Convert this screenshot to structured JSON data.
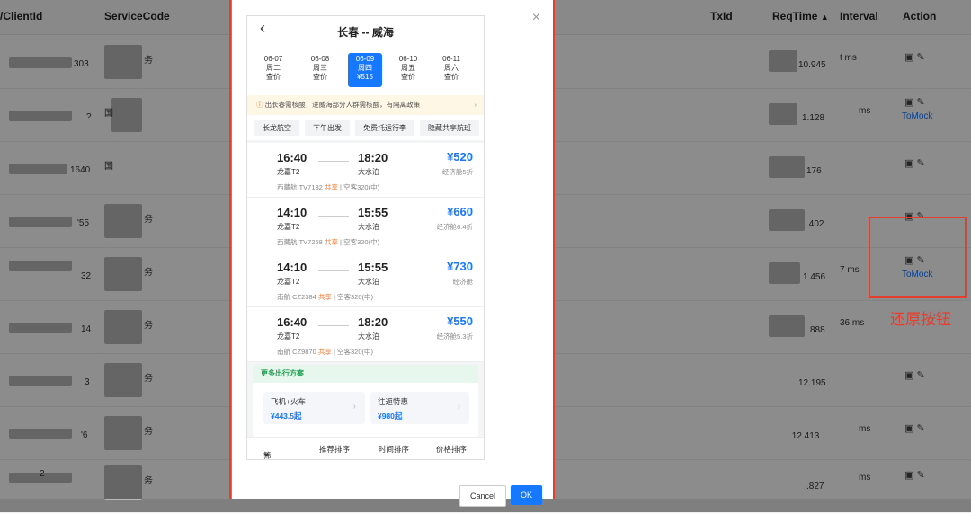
{
  "table": {
    "columns": [
      "/ClientId",
      "ServiceCode",
      "TxId",
      "ReqTime",
      "Interval",
      "Action"
    ],
    "sort_indicator": "▲"
  },
  "rows_visible": [
    {
      "client_frag": "303",
      "svc": "务",
      "req": "10.945",
      "interval": "t ms"
    },
    {
      "client_frag": "?",
      "svc": "国",
      "req": "1.128",
      "interval": "ms",
      "tomock": "ToMock"
    },
    {
      "client_frag": "1640",
      "svc": "国",
      "req": "176",
      "interval": ""
    },
    {
      "client_frag": "'55",
      "svc": "务",
      "req": ".402",
      "interval": ""
    },
    {
      "client_frag": "32",
      "svc": "务",
      "req": "1.456",
      "interval": "7 ms",
      "tomock": "ToMock"
    },
    {
      "client_frag": "14",
      "svc": "务",
      "req": "888",
      "interval": "36 ms"
    },
    {
      "client_frag": "3",
      "svc": "务",
      "req": "12.195",
      "interval": ""
    },
    {
      "client_frag": "'6",
      "svc": "务",
      "req": ".12.413",
      "interval": "ms"
    },
    {
      "client_frag": "2",
      "svc": "务",
      "req": ".827",
      "interval": "ms"
    }
  ],
  "annotation": {
    "label": "还原按钮",
    "color": "#e53e2e"
  },
  "modal": {
    "close": "×",
    "route_title": "长春 -- 威海",
    "dates": [
      {
        "date": "06-07",
        "weekday": "周二",
        "price": "查价"
      },
      {
        "date": "06-08",
        "weekday": "周三",
        "price": "查价"
      },
      {
        "date": "06-09",
        "weekday": "周四",
        "price": "¥515",
        "selected": true
      },
      {
        "date": "06-10",
        "weekday": "周五",
        "price": "查价"
      },
      {
        "date": "06-11",
        "weekday": "周六",
        "price": "查价"
      }
    ],
    "notice": "出长春需核酸，进威海部分人群需核酸，有隔离政策",
    "filters": [
      "长龙航空",
      "下午出发",
      "免费托运行李",
      "隐藏共享航班"
    ],
    "flights": [
      {
        "dep": "16:40",
        "arr": "18:20",
        "dep_ap": "龙嘉T2",
        "arr_ap": "大水泊",
        "price": "¥520",
        "cls": "经济舱5折",
        "airline": "西藏航 TV7132",
        "share": "共享",
        "plane": "空客320(中)"
      },
      {
        "dep": "14:10",
        "arr": "15:55",
        "dep_ap": "龙嘉T2",
        "arr_ap": "大水泊",
        "price": "¥660",
        "cls": "经济舱6.4折",
        "airline": "西藏航 TV7268",
        "share": "共享",
        "plane": "空客320(中)"
      },
      {
        "dep": "14:10",
        "arr": "15:55",
        "dep_ap": "龙嘉T2",
        "arr_ap": "大水泊",
        "price": "¥730",
        "cls": "经济舱",
        "airline": "南航 CZ2384",
        "share": "共享",
        "plane": "空客320(中)"
      },
      {
        "dep": "16:40",
        "arr": "18:20",
        "dep_ap": "龙嘉T2",
        "arr_ap": "大水泊",
        "price": "¥550",
        "cls": "经济舱5.3折",
        "airline": "南航 CZ9870",
        "share": "共享",
        "plane": "空客320(中)"
      }
    ],
    "more_title": "更多出行方案",
    "options": [
      {
        "name": "飞机+火车",
        "price": "¥443.5起"
      },
      {
        "name": "往返特惠",
        "price": "¥980起"
      }
    ],
    "bottom_tabs": [
      "筛选",
      "推荐排序",
      "时间排序",
      "价格排序"
    ],
    "cancel": "Cancel",
    "ok": "OK"
  }
}
